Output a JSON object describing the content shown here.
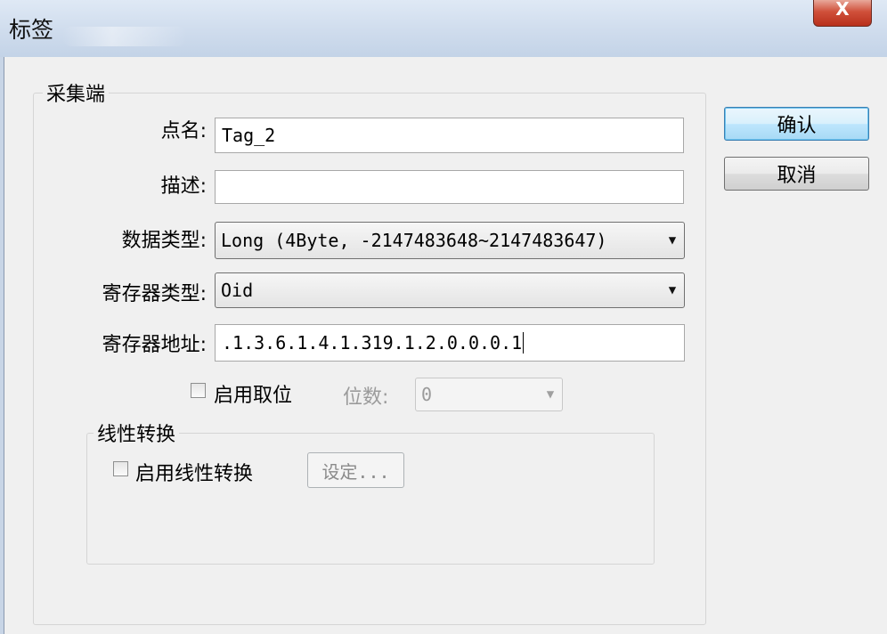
{
  "window": {
    "title": "标签",
    "close_glyph": "X"
  },
  "collector_group": {
    "label": "采集端"
  },
  "fields": {
    "tag_name": {
      "label": "点名:",
      "value": "Tag_2"
    },
    "description": {
      "label": "描述:",
      "value": ""
    },
    "data_type": {
      "label": "数据类型:",
      "value": "Long  (4Byte, -2147483648~2147483647)"
    },
    "register_type": {
      "label": "寄存器类型:",
      "value": "Oid"
    },
    "register_address": {
      "label": "寄存器地址:",
      "value": ".1.3.6.1.4.1.319.1.2.0.0.0.1"
    }
  },
  "bit_extract": {
    "checkbox_label": "启用取位",
    "bits_label": "位数:",
    "bits_value": "0",
    "checked": false
  },
  "linear_group": {
    "label": "线性转换",
    "checkbox_label": "启用线性转换",
    "settings_button": "设定...",
    "checked": false
  },
  "buttons": {
    "ok": "确认",
    "cancel": "取消"
  },
  "icons": {
    "dropdown": "chevron-down-icon",
    "close": "close-icon"
  }
}
